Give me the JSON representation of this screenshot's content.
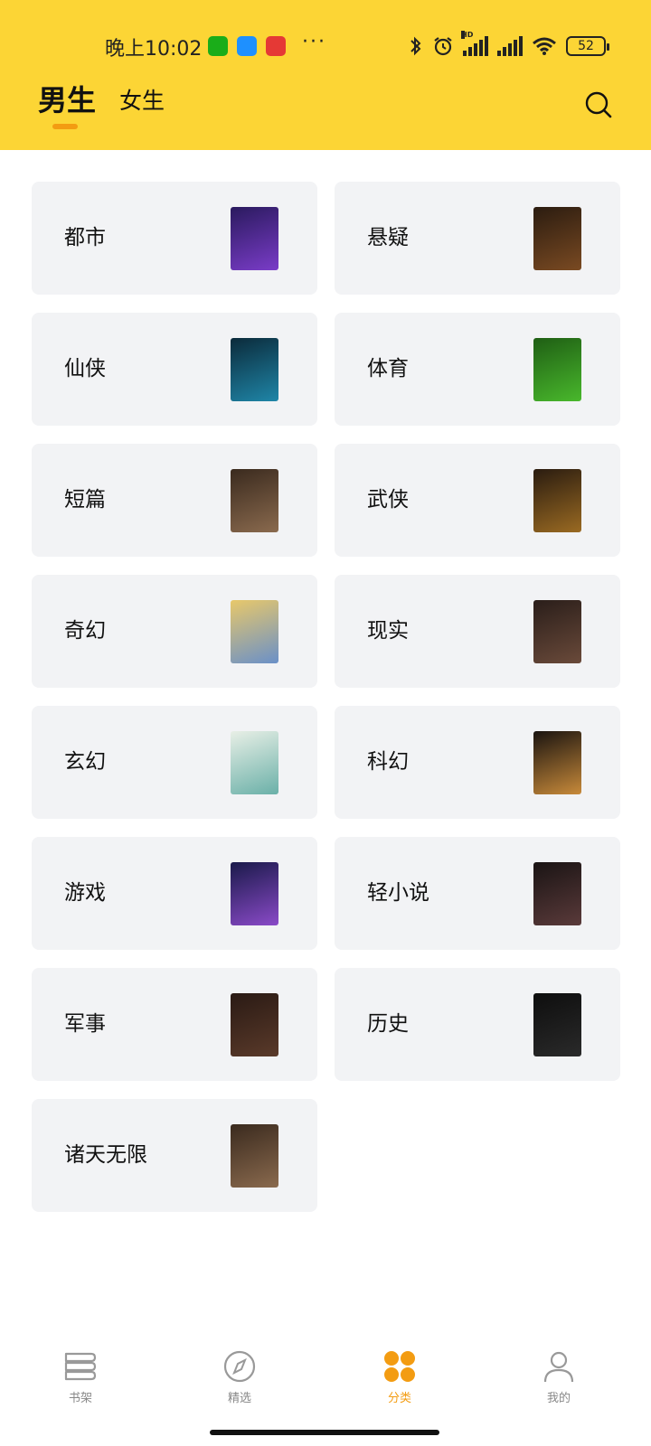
{
  "status_bar": {
    "time": "晚上10:02",
    "more": "···",
    "battery": "52",
    "hd": "HD"
  },
  "tabs": {
    "male": "男生",
    "female": "女生"
  },
  "categories": [
    {
      "label": "都市",
      "colors": [
        "#2a1a5e",
        "#7a3cc8"
      ]
    },
    {
      "label": "悬疑",
      "colors": [
        "#2b1c10",
        "#7a4a22"
      ]
    },
    {
      "label": "仙侠",
      "colors": [
        "#0b2a3a",
        "#1f86a8"
      ]
    },
    {
      "label": "体育",
      "colors": [
        "#1f5e14",
        "#49b82c"
      ]
    },
    {
      "label": "短篇",
      "colors": [
        "#3a2a1e",
        "#8a6a4e"
      ]
    },
    {
      "label": "武侠",
      "colors": [
        "#2a1c10",
        "#9a6a22"
      ]
    },
    {
      "label": "奇幻",
      "colors": [
        "#e8c86a",
        "#6a90c8"
      ]
    },
    {
      "label": "现实",
      "colors": [
        "#2a1e1a",
        "#6a4a3a"
      ]
    },
    {
      "label": "玄幻",
      "colors": [
        "#e8efe6",
        "#6ab0a8"
      ]
    },
    {
      "label": "科幻",
      "colors": [
        "#1a1410",
        "#c88a3a"
      ]
    },
    {
      "label": "游戏",
      "colors": [
        "#1a1a4a",
        "#8a4ac8"
      ]
    },
    {
      "label": "轻小说",
      "colors": [
        "#1a1414",
        "#5a3a3a"
      ]
    },
    {
      "label": "军事",
      "colors": [
        "#2a1a14",
        "#5a3a2a"
      ]
    },
    {
      "label": "历史",
      "colors": [
        "#0e0e0e",
        "#2a2a2a"
      ]
    },
    {
      "label": "诸天无限",
      "colors": [
        "#3a2a1e",
        "#8a6a4e"
      ]
    }
  ],
  "bottom_nav": [
    {
      "label": "书架",
      "icon": "bookshelf-icon"
    },
    {
      "label": "精选",
      "icon": "compass-icon"
    },
    {
      "label": "分类",
      "icon": "category-icon"
    },
    {
      "label": "我的",
      "icon": "user-icon"
    }
  ],
  "colors": {
    "header": "#FCD535",
    "accent": "#F39C12",
    "card": "#F2F3F5"
  }
}
